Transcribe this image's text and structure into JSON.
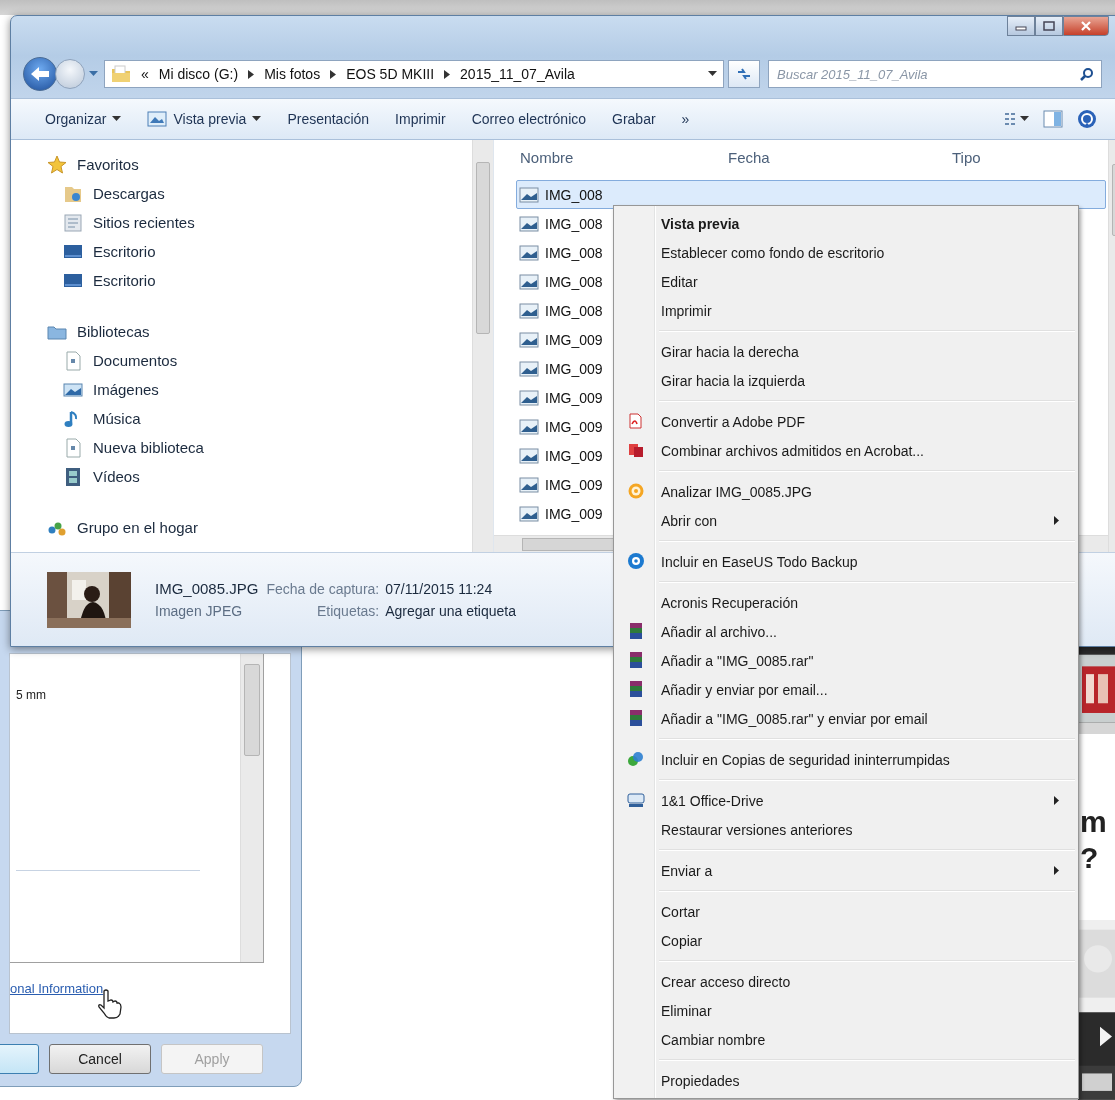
{
  "explorer": {
    "breadcrumb": {
      "overflow": "«",
      "segments": [
        "Mi disco (G:)",
        "Mis fotos",
        "EOS 5D MKIII",
        "2015_11_07_Avila"
      ]
    },
    "search": {
      "placeholder": "Buscar 2015_11_07_Avila"
    },
    "toolbar": [
      {
        "label": "Organizar",
        "dropdown": true,
        "kind": "plain"
      },
      {
        "label": "Vista previa",
        "dropdown": true,
        "kind": "preview"
      },
      {
        "label": "Presentación",
        "dropdown": false,
        "kind": "plain"
      },
      {
        "label": "Imprimir",
        "dropdown": false,
        "kind": "plain"
      },
      {
        "label": "Correo electrónico",
        "dropdown": false,
        "kind": "plain"
      },
      {
        "label": "Grabar",
        "dropdown": false,
        "kind": "plain"
      },
      {
        "label": "»",
        "dropdown": false,
        "kind": "plain"
      }
    ],
    "nav": [
      {
        "label": "Favoritos",
        "kind": "star",
        "children": [
          {
            "label": "Descargas",
            "kind": "downloads"
          },
          {
            "label": "Sitios recientes",
            "kind": "recent"
          },
          {
            "label": "Escritorio",
            "kind": "desktop"
          },
          {
            "label": "Escritorio",
            "kind": "desktop"
          }
        ]
      },
      {
        "label": "Bibliotecas",
        "kind": "library",
        "children": [
          {
            "label": "Documentos",
            "kind": "document"
          },
          {
            "label": "Imágenes",
            "kind": "pictures"
          },
          {
            "label": "Música",
            "kind": "music"
          },
          {
            "label": "Nueva biblioteca",
            "kind": "document"
          },
          {
            "label": "Vídeos",
            "kind": "videos"
          }
        ]
      },
      {
        "label": "Grupo en el hogar",
        "kind": "homegroup"
      }
    ],
    "columns": [
      "Nombre",
      "Fecha",
      "Tipo"
    ],
    "files": [
      {
        "name": "IMG_008",
        "selected": true
      },
      {
        "name": "IMG_008",
        "selected": false
      },
      {
        "name": "IMG_008",
        "selected": false
      },
      {
        "name": "IMG_008",
        "selected": false
      },
      {
        "name": "IMG_008",
        "selected": false
      },
      {
        "name": "IMG_009",
        "selected": false
      },
      {
        "name": "IMG_009",
        "selected": false
      },
      {
        "name": "IMG_009",
        "selected": false
      },
      {
        "name": "IMG_009",
        "selected": false
      },
      {
        "name": "IMG_009",
        "selected": false
      },
      {
        "name": "IMG_009",
        "selected": false
      },
      {
        "name": "IMG_009",
        "selected": false
      }
    ],
    "details": {
      "name": "IMG_0085.JPG",
      "type": "Imagen JPEG",
      "fields": [
        {
          "label": "Fecha de captura:",
          "value": "07/11/2015 11:24"
        },
        {
          "label": "Etiquetas:",
          "value": "Agregar una etiqueta"
        }
      ]
    }
  },
  "context_menu": {
    "groups": [
      [
        {
          "label": "Vista previa",
          "bold": true,
          "kind": "plain",
          "submenu": false
        },
        {
          "label": "Establecer como fondo de escritorio",
          "bold": false,
          "kind": "plain",
          "submenu": false
        },
        {
          "label": "Editar",
          "bold": false,
          "kind": "plain",
          "submenu": false
        },
        {
          "label": "Imprimir",
          "bold": false,
          "kind": "plain",
          "submenu": false
        }
      ],
      [
        {
          "label": "Girar hacia la derecha",
          "bold": false,
          "kind": "plain",
          "submenu": false
        },
        {
          "label": "Girar hacia la izquierda",
          "bold": false,
          "kind": "plain",
          "submenu": false
        }
      ],
      [
        {
          "label": "Convertir a Adobe PDF",
          "bold": false,
          "kind": "pdf",
          "submenu": false
        },
        {
          "label": "Combinar archivos admitidos en Acrobat...",
          "bold": false,
          "kind": "acrobat",
          "submenu": false
        }
      ],
      [
        {
          "label": "Analizar IMG_0085.JPG",
          "bold": false,
          "kind": "scan",
          "submenu": false
        },
        {
          "label": "Abrir con",
          "bold": false,
          "kind": "plain",
          "submenu": true
        }
      ],
      [
        {
          "label": "Incluir en EaseUS Todo Backup",
          "bold": false,
          "kind": "easeus",
          "submenu": false
        }
      ],
      [
        {
          "label": "Acronis Recuperación",
          "bold": false,
          "kind": "plain",
          "submenu": false
        },
        {
          "label": "Añadir al archivo...",
          "bold": false,
          "kind": "rar",
          "submenu": false
        },
        {
          "label": "Añadir a \"IMG_0085.rar\"",
          "bold": false,
          "kind": "rar",
          "submenu": false
        },
        {
          "label": "Añadir y enviar por email...",
          "bold": false,
          "kind": "rar",
          "submenu": false
        },
        {
          "label": "Añadir a \"IMG_0085.rar\" y enviar por email",
          "bold": false,
          "kind": "rar",
          "submenu": false
        }
      ],
      [
        {
          "label": "Incluir en Copias de seguridad ininterrumpidas",
          "bold": false,
          "kind": "sync",
          "submenu": false
        }
      ],
      [
        {
          "label": "1&1 Office-Drive",
          "bold": false,
          "kind": "drive",
          "submenu": true
        },
        {
          "label": "Restaurar versiones anteriores",
          "bold": false,
          "kind": "plain",
          "submenu": false
        }
      ],
      [
        {
          "label": "Enviar a",
          "bold": false,
          "kind": "plain",
          "submenu": true
        }
      ],
      [
        {
          "label": "Cortar",
          "bold": false,
          "kind": "plain",
          "submenu": false
        },
        {
          "label": "Copiar",
          "bold": false,
          "kind": "plain",
          "submenu": false
        }
      ],
      [
        {
          "label": "Crear acceso directo",
          "bold": false,
          "kind": "plain",
          "submenu": false
        },
        {
          "label": "Eliminar",
          "bold": false,
          "kind": "plain",
          "submenu": false
        },
        {
          "label": "Cambiar nombre",
          "bold": false,
          "kind": "plain",
          "submenu": false
        }
      ],
      [
        {
          "label": "Propiedades",
          "bold": false,
          "kind": "plain",
          "submenu": false
        }
      ]
    ]
  },
  "dialog": {
    "value": "5 mm",
    "link": "onal Information",
    "buttons": [
      {
        "label": "Cancel",
        "disabled": false
      },
      {
        "label": "Apply",
        "disabled": true
      }
    ]
  },
  "background_page": {
    "texts": [
      "m",
      "?"
    ]
  }
}
